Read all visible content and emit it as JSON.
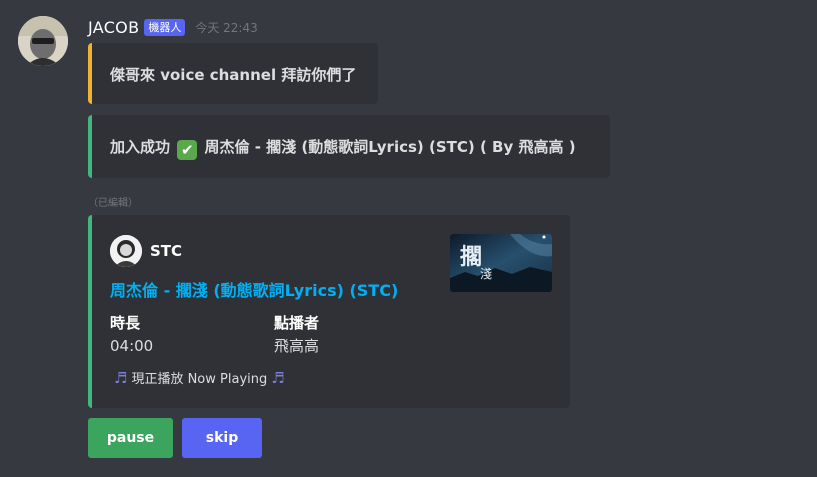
{
  "message": {
    "author": "JACOB",
    "bot_tag": "機器人",
    "timestamp": "今天 22:43",
    "edited_label": "（已編輯）"
  },
  "embeds": [
    {
      "text": "傑哥來 voice channel 拜訪你們了",
      "accent_color": "#f0b232"
    },
    {
      "text_before": "加入成功",
      "check_icon": "✔",
      "text_after": "周杰倫 - 擱淺 (動態歌詞Lyrics) (STC) ( By 飛高高 )",
      "accent_color": "#43b581"
    },
    {
      "author": "STC",
      "title": "周杰倫 - 擱淺 (動態歌詞Lyrics) (STC)",
      "thumbnail_text": "擱淺",
      "fields": [
        {
          "name": "時長",
          "value": "04:00"
        },
        {
          "name": "點播者",
          "value": "飛高高"
        }
      ],
      "footer": "現正播放 Now Playing",
      "footer_icon": "♬",
      "accent_color": "#43b581",
      "title_color": "#00aff4"
    }
  ],
  "buttons": {
    "pause": "pause",
    "skip": "skip"
  },
  "colors": {
    "background": "#36393f",
    "embed_bg": "#2f3136",
    "pause_button": "#3ba55d",
    "skip_button": "#5865f2",
    "bot_tag": "#5865f2"
  }
}
